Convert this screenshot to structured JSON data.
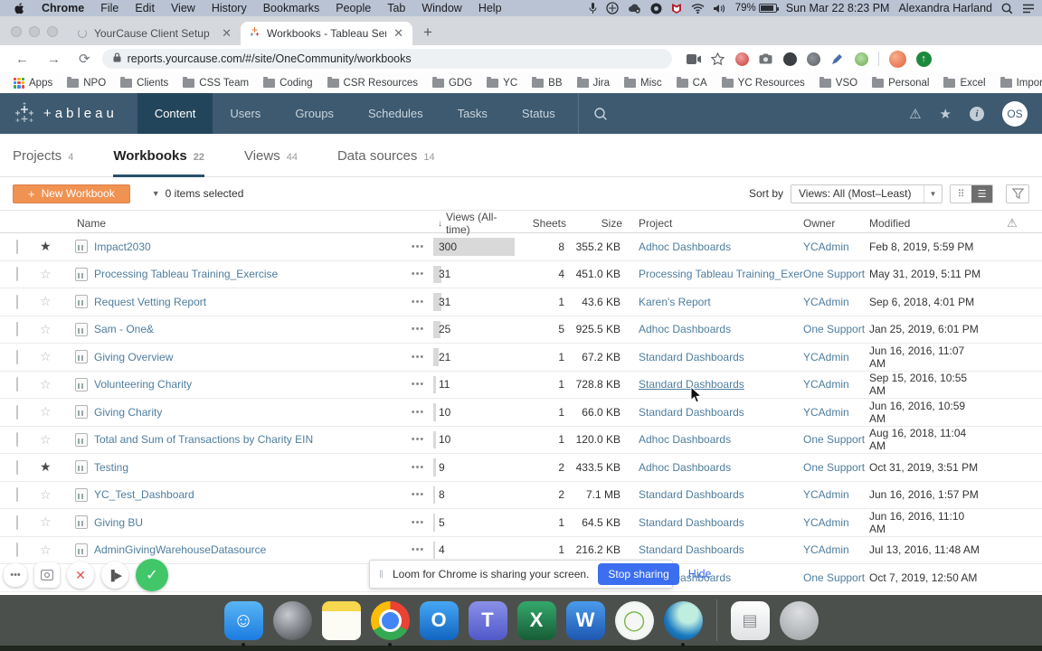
{
  "menu_bar": {
    "items": [
      {
        "label": "Chrome",
        "bold": true
      },
      {
        "label": "File"
      },
      {
        "label": "Edit"
      },
      {
        "label": "View"
      },
      {
        "label": "History"
      },
      {
        "label": "Bookmarks"
      },
      {
        "label": "People"
      },
      {
        "label": "Tab"
      },
      {
        "label": "Window"
      },
      {
        "label": "Help"
      }
    ],
    "status_icons": [
      "microphone-icon",
      "screen-mirroring-icon",
      "cloud-sync-icon",
      "loom-icon",
      "mcafee-shield-icon",
      "wifi-icon",
      "volume-icon"
    ],
    "battery_percent": "79%",
    "datetime": "Sun Mar 22  8:23 PM",
    "user": "Alexandra Harland"
  },
  "browser": {
    "tabs": [
      {
        "title": "YourCause Client Setup",
        "spinner": true
      },
      {
        "title": "Workbooks - Tableau Server",
        "tableau": true,
        "active": true
      }
    ],
    "new_tab": "+",
    "url": "reports.yourcause.com/#/site/OneCommunity/workbooks",
    "bookmarks": [
      {
        "label": "Apps",
        "apps": true
      },
      {
        "label": "NPO"
      },
      {
        "label": "Clients"
      },
      {
        "label": "CSS Team"
      },
      {
        "label": "Coding"
      },
      {
        "label": "CSR Resources"
      },
      {
        "label": "GDG"
      },
      {
        "label": "YC"
      },
      {
        "label": "BB"
      },
      {
        "label": "Jira"
      },
      {
        "label": "Misc"
      },
      {
        "label": "CA"
      },
      {
        "label": "YC Resources"
      },
      {
        "label": "VSO"
      },
      {
        "label": "Personal"
      },
      {
        "label": "Excel"
      },
      {
        "label": "Imported"
      }
    ]
  },
  "tableau_nav": {
    "wordmark": "+ableau",
    "items": [
      {
        "label": "Content",
        "active": true
      },
      {
        "label": "Users"
      },
      {
        "label": "Groups"
      },
      {
        "label": "Schedules"
      },
      {
        "label": "Tasks"
      },
      {
        "label": "Status"
      }
    ],
    "avatar": "OS"
  },
  "page": {
    "tabs": [
      {
        "label": "Projects",
        "count": "4"
      },
      {
        "label": "Workbooks",
        "count": "22",
        "active": true
      },
      {
        "label": "Views",
        "count": "44"
      },
      {
        "label": "Data sources",
        "count": "14"
      }
    ],
    "toolbar": {
      "new_workbook": "New Workbook",
      "plus": "+",
      "selection": "0 items selected",
      "sort_by_label": "Sort by",
      "sort_value": "Views: All (Most–Least)"
    },
    "table": {
      "sort_arrow": "↓",
      "headers": {
        "name": "Name",
        "views": "Views (All-time)",
        "sheets": "Sheets",
        "size": "Size",
        "project": "Project",
        "owner": "Owner",
        "modified": "Modified",
        "warn": "⚠"
      },
      "max_views": 300,
      "rows": [
        {
          "name": "Impact2030",
          "starred": true,
          "views": "300",
          "sheets": "8",
          "size": "355.2 KB",
          "project": "Adhoc Dashboards",
          "owner": "YCAdmin",
          "modified": "Feb 8, 2019, 5:59 PM"
        },
        {
          "name": "Processing Tableau Training_Exercise",
          "views": "31",
          "sheets": "4",
          "size": "451.0 KB",
          "project": "Processing Tableau Training_Exercise",
          "owner": "One Support",
          "modified": "May 31, 2019, 5:11 PM"
        },
        {
          "name": "Request Vetting Report",
          "views": "31",
          "sheets": "1",
          "size": "43.6 KB",
          "project": "Karen's Report",
          "owner": "YCAdmin",
          "modified": "Sep 6, 2018, 4:01 PM"
        },
        {
          "name": "Sam - One&",
          "views": "25",
          "sheets": "5",
          "size": "925.5 KB",
          "project": "Adhoc Dashboards",
          "owner": "One Support",
          "modified": "Jan 25, 2019, 6:01 PM"
        },
        {
          "name": "Giving Overview",
          "views": "21",
          "sheets": "1",
          "size": "67.2 KB",
          "project": "Standard Dashboards",
          "owner": "YCAdmin",
          "modified": "Jun 16, 2016, 11:07 AM"
        },
        {
          "name": "Volunteering Charity",
          "views": "11",
          "sheets": "1",
          "size": "728.8 KB",
          "project": "Standard Dashboards",
          "hover": true,
          "owner": "YCAdmin",
          "modified": "Sep 15, 2016, 10:55 AM"
        },
        {
          "name": "Giving Charity",
          "views": "10",
          "sheets": "1",
          "size": "66.0 KB",
          "project": "Standard Dashboards",
          "owner": "YCAdmin",
          "modified": "Jun 16, 2016, 10:59 AM"
        },
        {
          "name": "Total and Sum of Transactions by Charity EIN",
          "views": "10",
          "sheets": "1",
          "size": "120.0 KB",
          "project": "Adhoc Dashboards",
          "owner": "One Support",
          "modified": "Aug 16, 2018, 11:04 AM"
        },
        {
          "name": "Testing",
          "starred": true,
          "views": "9",
          "sheets": "2",
          "size": "433.5 KB",
          "project": "Adhoc Dashboards",
          "owner": "One Support",
          "modified": "Oct 31, 2019, 3:51 PM"
        },
        {
          "name": "YC_Test_Dashboard",
          "views": "8",
          "sheets": "2",
          "size": "7.1 MB",
          "project": "Standard Dashboards",
          "owner": "YCAdmin",
          "modified": "Jun 16, 2016, 1:57 PM"
        },
        {
          "name": "Giving BU",
          "views": "5",
          "sheets": "1",
          "size": "64.5 KB",
          "project": "Standard Dashboards",
          "owner": "YCAdmin",
          "modified": "Jun 16, 2016, 11:10 AM"
        },
        {
          "name": "AdminGivingWarehouseDatasource",
          "views": "4",
          "sheets": "1",
          "size": "216.2 KB",
          "project": "Standard Dashboards",
          "owner": "YCAdmin",
          "modified": "Jul 13, 2016, 11:48 AM"
        },
        {
          "name": "",
          "views": "",
          "sheets": "",
          "size": "",
          "project": "Adhoc Dashboards",
          "owner": "One Support",
          "modified": "Oct 7, 2019, 12:50 AM",
          "obscured": true
        }
      ]
    }
  },
  "loom": {
    "message": "Loom for Chrome is sharing your screen.",
    "stop": "Stop sharing",
    "hide": "Hide"
  },
  "dock": {
    "apps": [
      {
        "name": "finder",
        "glyph": "☺",
        "bg": "linear-gradient(180deg,#59b5f5,#1c7ce0)",
        "running": true
      },
      {
        "name": "launchpad",
        "glyph": "",
        "bg": "radial-gradient(circle at 38% 35%,#c6cad0,#3c3f44)"
      },
      {
        "name": "notes",
        "glyph": "",
        "bg": "linear-gradient(180deg,#f6d74d 0 26%,#fcfbf4 26%)"
      },
      {
        "name": "chrome",
        "glyph": "",
        "bg": "",
        "running": true
      },
      {
        "name": "outlook",
        "glyph": "O",
        "bg": "linear-gradient(180deg,#45a7f5,#1265c0)"
      },
      {
        "name": "teams",
        "glyph": "T",
        "bg": "linear-gradient(180deg,#8a90e8,#5059c9)"
      },
      {
        "name": "excel",
        "glyph": "X",
        "bg": "linear-gradient(180deg,#33a96c,#185c36)"
      },
      {
        "name": "word",
        "glyph": "W",
        "bg": "linear-gradient(180deg,#4a9bec,#1f57b0)"
      },
      {
        "name": "anyconnect",
        "glyph": "◯",
        "bg": "radial-gradient(circle,#f4f7f4 60%,#d7dcd7 100%)",
        "fg": "#79b54a"
      },
      {
        "name": "webex",
        "glyph": "",
        "bg": "radial-gradient(circle at 62% 32%,#bfeee0 0 26%,#1a7ac0 62%,#14476e 100%)",
        "running": true
      },
      {
        "name": "divider",
        "glyph": "",
        "bg": "",
        "divider": true
      },
      {
        "name": "docs",
        "glyph": "▤",
        "bg": "linear-gradient(180deg,#ffffff,#dfe1e3)",
        "fg": "#8a8f94"
      },
      {
        "name": "trash",
        "glyph": "",
        "bg": "radial-gradient(circle at 50% 28%,#dcdee0,#9fa2a6)"
      }
    ]
  }
}
